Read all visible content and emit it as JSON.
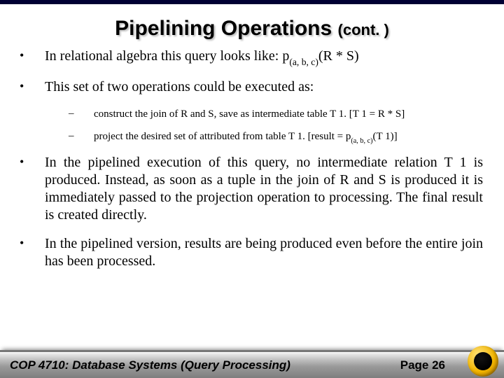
{
  "title": {
    "main": "Pipelining Operations",
    "cont": "(cont. )"
  },
  "bullets": {
    "b1_prefix": "In relational algebra this query looks like: ",
    "b1_sub": "(a, b, c)",
    "b1_suffix": "(R * S)",
    "b2": "This set of two operations could be executed as:",
    "b2a": "construct the join of R and S, save as intermediate table T 1.  [T 1 = R * S]",
    "b2b_prefix": "project the desired set of attributed from table T 1.  [result = ",
    "b2b_sub": "(a, b, c)",
    "b2b_suffix": "(T 1)]",
    "b3": "In the pipelined execution of this query, no intermediate relation T 1 is produced.  Instead, as soon as a tuple in the join of R and S is produced it is immediately passed to the projection operation to processing.  The final result is created directly.",
    "b4": "In the pipelined version, results are being produced even before the entire join has been processed."
  },
  "footer": {
    "course": "COP 4710: Database Systems (Query Processing)",
    "page": "Page 26"
  },
  "glyphs": {
    "pi": "p",
    "dash": "–",
    "dot": "•"
  }
}
